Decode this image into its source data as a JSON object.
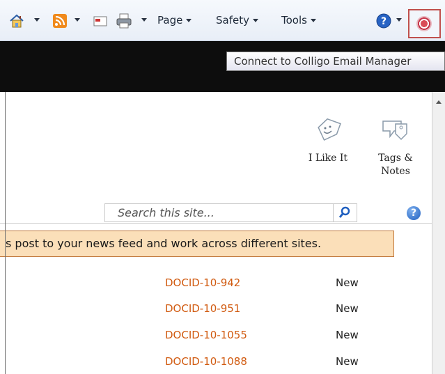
{
  "command_bar": {
    "page_label": "Page",
    "safety_label": "Safety",
    "tools_label": "Tools"
  },
  "tooltip": "Connect to Colligo Email Manager",
  "social": {
    "like_label": "I Like It",
    "tags_label": "Tags & Notes"
  },
  "search": {
    "placeholder": "Search this site..."
  },
  "notice": "s post to your news feed and work across different sites.",
  "documents": [
    {
      "id": "DOCID-10-942",
      "status": "New"
    },
    {
      "id": "DOCID-10-951",
      "status": "New"
    },
    {
      "id": "DOCID-10-1055",
      "status": "New"
    },
    {
      "id": "DOCID-10-1088",
      "status": "New"
    }
  ],
  "colors": {
    "link": "#d15b11",
    "notice_bg": "#fbdfb9",
    "highlight_border": "#c0504d"
  },
  "icons": [
    "home-icon",
    "rss-feed-icon",
    "read-mail-icon",
    "print-icon",
    "help-icon",
    "colligo-icon",
    "like-tag-icon",
    "tags-notes-icon",
    "search-icon"
  ]
}
